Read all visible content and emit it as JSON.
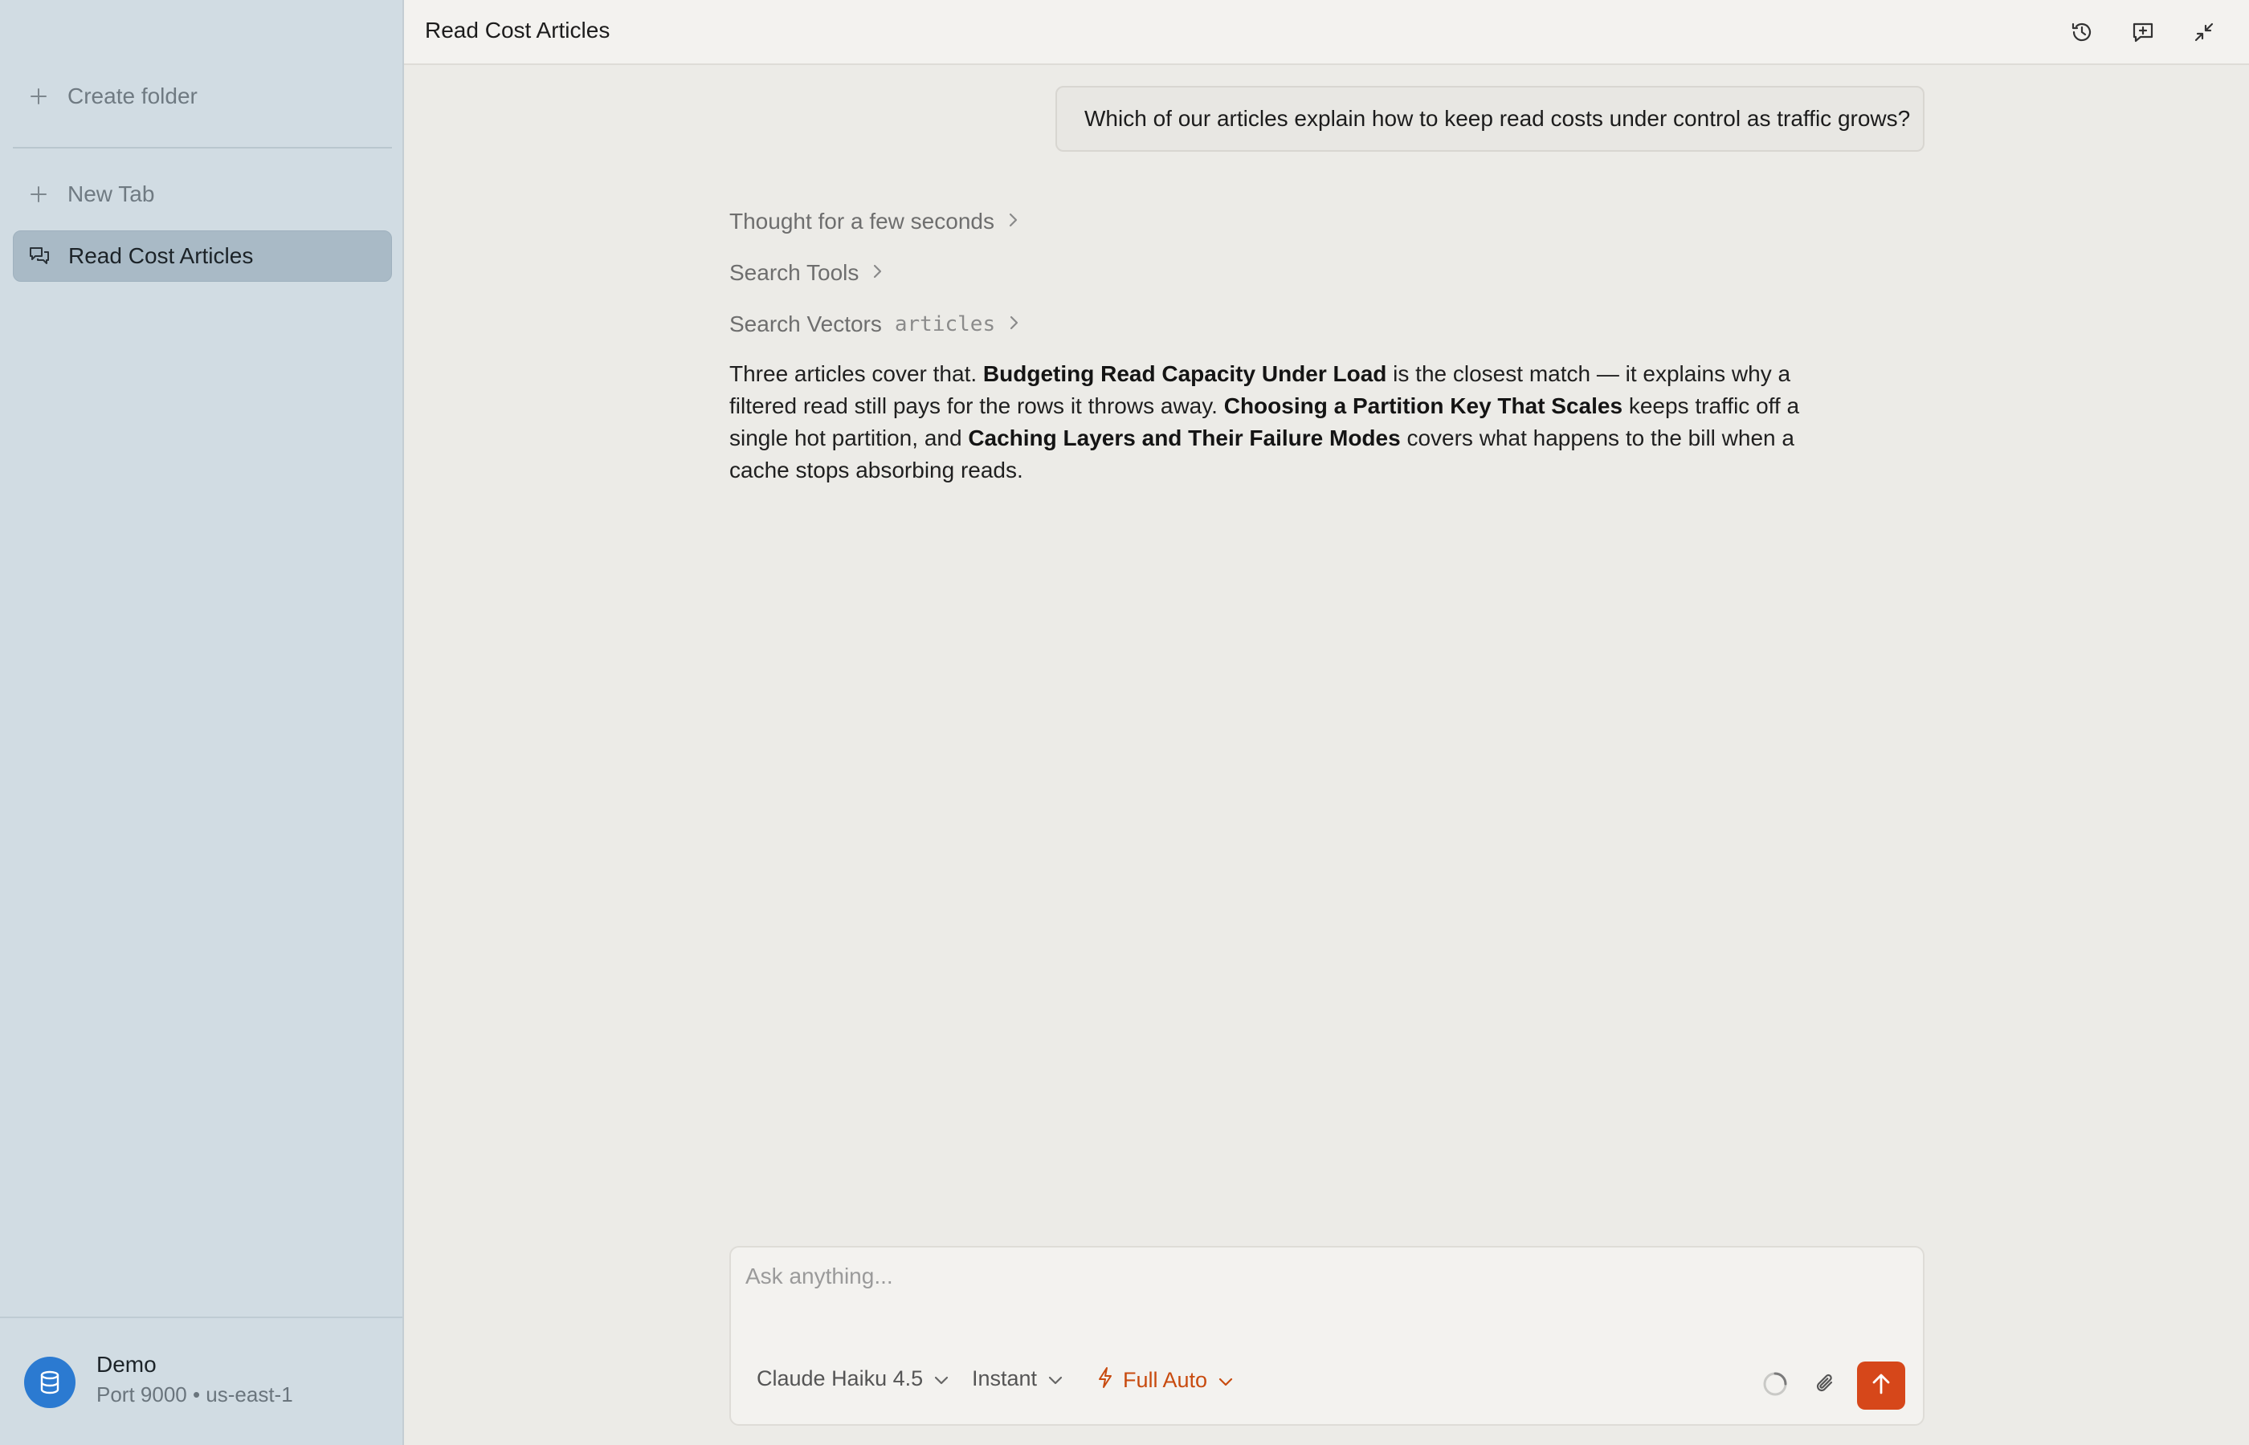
{
  "sidebar": {
    "create_folder": "Create folder",
    "new_tab": "New Tab",
    "active_item": "Read Cost Articles",
    "footer": {
      "name": "Demo",
      "sub": "Port 9000 • us-east-1"
    }
  },
  "header": {
    "title": "Read Cost Articles",
    "icons": [
      "history-icon",
      "new-chat-icon",
      "collapse-icon"
    ]
  },
  "chat": {
    "user_message": "Which of our articles explain how to keep read costs under control as traffic grows?",
    "steps": {
      "thought": "Thought for a few seconds",
      "search_tools": "Search Tools",
      "search_vectors": "Search Vectors",
      "search_vectors_arg": "articles"
    },
    "answer": {
      "p1": "Three articles cover that. ",
      "b1": "Budgeting Read Capacity Under Load",
      "p2": " is the closest match — it explains why a filtered read still pays for the rows it throws away. ",
      "b2": "Choosing a Partition Key That Scales",
      "p3": " keeps traffic off a single hot partition, and ",
      "b3": "Caching Layers and Their Failure Modes",
      "p4": " covers what happens to the bill when a cache stops absorbing reads."
    }
  },
  "composer": {
    "placeholder": "Ask anything...",
    "model": "Claude Haiku 4.5",
    "speed": "Instant",
    "mode": "Full Auto"
  },
  "colors": {
    "accent": "#d6471a",
    "sidebar_bg": "#d1dce3",
    "active_item_bg": "#a9bac6",
    "main_bg": "#ecebe7",
    "db_avatar": "#2b7ad1"
  }
}
